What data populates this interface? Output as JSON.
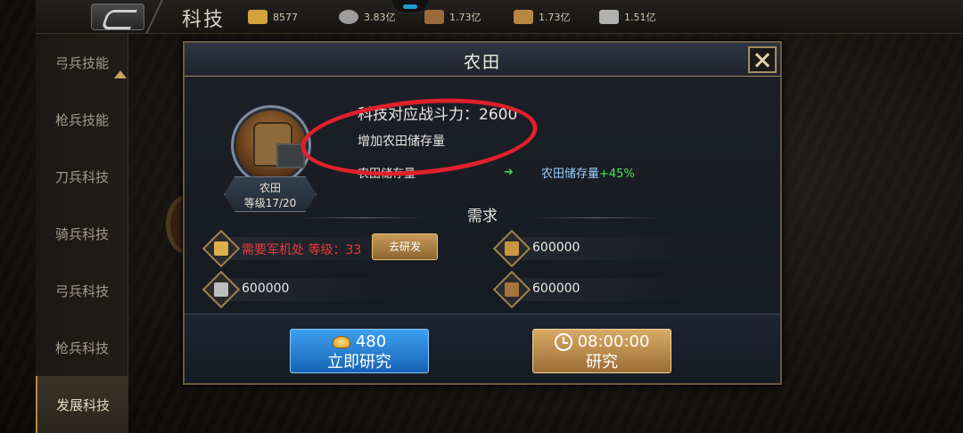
{
  "topbar": {
    "title": "科技",
    "resources": [
      {
        "name": "gold-ingot",
        "value": "8577",
        "color": "#d4a23c"
      },
      {
        "name": "coin",
        "value": "3.83亿",
        "color": "#9c9c9c"
      },
      {
        "name": "wood",
        "value": "1.73亿",
        "color": "#9a6b3a"
      },
      {
        "name": "food",
        "value": "1.73亿",
        "color": "#b6873e"
      },
      {
        "name": "iron",
        "value": "1.51亿",
        "color": "#b0b0b0"
      }
    ]
  },
  "sidebar": {
    "items": [
      {
        "label": "弓兵技能",
        "active": false
      },
      {
        "label": "枪兵技能",
        "active": false
      },
      {
        "label": "刀兵科技",
        "active": false
      },
      {
        "label": "骑兵科技",
        "active": false
      },
      {
        "label": "弓兵科技",
        "active": false
      },
      {
        "label": "枪兵科技",
        "active": false
      },
      {
        "label": "发展科技",
        "active": true
      }
    ]
  },
  "modal": {
    "title": "农田",
    "tech": {
      "name": "农田",
      "level_label": "等级",
      "level_current": "17",
      "level_sep": "/",
      "level_max": "20"
    },
    "power": "科技对应战斗力：2600",
    "description": "增加农田储存量",
    "effect_left": "农田储存量",
    "effect_arrow": "➜",
    "effect_right": "农田储存量",
    "effect_bonus": "+45%",
    "requirements_title": "需求",
    "requirements": {
      "building": "需要军机处 等级：33",
      "go_button": "去研发",
      "food": "600000",
      "iron": "600000",
      "wood": "600000"
    },
    "instant_button": {
      "cost": "480",
      "label": "立即研究"
    },
    "research_button": {
      "time": "08:00:00",
      "label": "研究"
    }
  }
}
